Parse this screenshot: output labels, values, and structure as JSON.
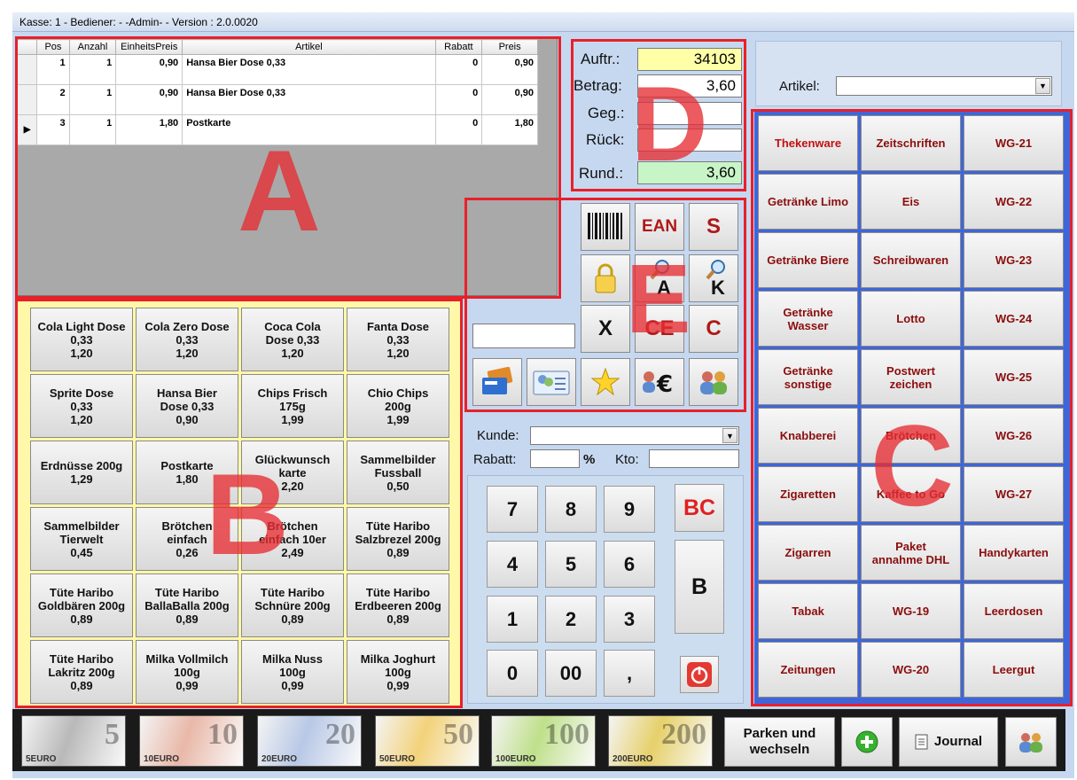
{
  "titlebar": "Kasse: 1 - Bediener: - -Admin- - Version : 2.0.0020",
  "grid": {
    "columns": [
      "Pos",
      "Anzahl",
      "EinheitsPreis",
      "Artikel",
      "Rabatt",
      "Preis"
    ],
    "rows": [
      {
        "pos": "1",
        "anzahl": "1",
        "einheit": "0,90",
        "artikel": "Hansa Bier Dose 0,33",
        "rabatt": "0",
        "preis": "0,90"
      },
      {
        "pos": "2",
        "anzahl": "1",
        "einheit": "0,90",
        "artikel": "Hansa Bier Dose 0,33",
        "rabatt": "0",
        "preis": "0,90"
      },
      {
        "pos": "3",
        "anzahl": "1",
        "einheit": "1,80",
        "artikel": "Postkarte",
        "rabatt": "0",
        "preis": "1,80"
      }
    ]
  },
  "region_labels": {
    "a": "A",
    "b": "B",
    "c": "C",
    "d": "D",
    "e": "E"
  },
  "totals": {
    "auftr_label": "Auftr.:",
    "auftr": "34103",
    "betrag_label": "Betrag:",
    "betrag": "3,60",
    "geg_label": "Geg.:",
    "geg": "",
    "rueck_label": "Rück:",
    "rueck": "",
    "rund_label": "Rund.:",
    "rund": "3,60"
  },
  "artikel_label": "Artikel:",
  "function_buttons": {
    "ean": "EAN",
    "s": "S",
    "a": "A",
    "k": "K",
    "x": "X",
    "ce": "CE",
    "c": "C"
  },
  "customer": {
    "kunde_label": "Kunde:",
    "rabatt_label": "Rabatt:",
    "percent": "%",
    "kto_label": "Kto:"
  },
  "products": [
    "Cola Light Dose\n0,33\n1,20",
    "Cola Zero Dose\n0,33\n1,20",
    "Coca Cola\nDose 0,33\n1,20",
    "Fanta Dose\n0,33\n1,20",
    "Sprite Dose\n0,33\n1,20",
    "Hansa Bier\nDose 0,33\n0,90",
    "Chips Frisch\n175g\n1,99",
    "Chio Chips\n200g\n1,99",
    "Erdnüsse 200g\n1,29",
    "Postkarte\n1,80",
    "Glückwunsch\nkarte\n2,20",
    "Sammelbilder\nFussball\n0,50",
    "Sammelbilder\nTierwelt\n0,45",
    "Brötchen\neinfach\n0,26",
    "Brötchen\neinfach 10er\n2,49",
    "Tüte Haribo\nSalzbrezel 200g\n0,89",
    "Tüte Haribo\nGoldbären 200g\n0,89",
    "Tüte Haribo\nBallaBalla 200g\n0,89",
    "Tüte Haribo\nSchnüre 200g\n0,89",
    "Tüte Haribo\nErdbeeren 200g\n0,89",
    "Tüte Haribo\nLakritz 200g\n0,89",
    "Milka Vollmilch\n100g\n0,99",
    "Milka Nuss\n100g\n0,99",
    "Milka Joghurt\n100g\n0,99"
  ],
  "categories": [
    "Thekenware",
    "Zeitschriften",
    "WG-21",
    "Getränke Limo",
    "Eis",
    "WG-22",
    "Getränke Biere",
    "Schreibwaren",
    "WG-23",
    "Getränke\nWasser",
    "Lotto",
    "WG-24",
    "Getränke\nsonstige",
    "Postwert\nzeichen",
    "WG-25",
    "Knabberei",
    "Brötchen",
    "WG-26",
    "Zigaretten",
    "Kaffee to Go",
    "WG-27",
    "Zigarren",
    "Paket\nannahme DHL",
    "Handykarten",
    "Tabak",
    "WG-19",
    "Leerdosen",
    "Zeitungen",
    "WG-20",
    "Leergut"
  ],
  "keypad": {
    "k7": "7",
    "k8": "8",
    "k9": "9",
    "k4": "4",
    "k5": "5",
    "k6": "6",
    "k1": "1",
    "k2": "2",
    "k3": "3",
    "k0": "0",
    "k00": "00",
    "comma": ",",
    "bc": "BC",
    "b": "B"
  },
  "banknotes": [
    "5",
    "10",
    "20",
    "50",
    "100",
    "200"
  ],
  "banknote_small": [
    "5EURO",
    "10EURO",
    "20EURO",
    "50EURO",
    "100EURO",
    "200EURO"
  ],
  "bottom": {
    "parken": "Parken und\nwechseln",
    "journal": "Journal"
  },
  "colors": {
    "window": "#c6d8ef",
    "highlight_red": "#e8202a",
    "category_blue": "#3f66d9",
    "product_yellow": "#fff8a8",
    "auftr_bg": "#ffffa8",
    "rund_bg": "#c8f5c8"
  }
}
